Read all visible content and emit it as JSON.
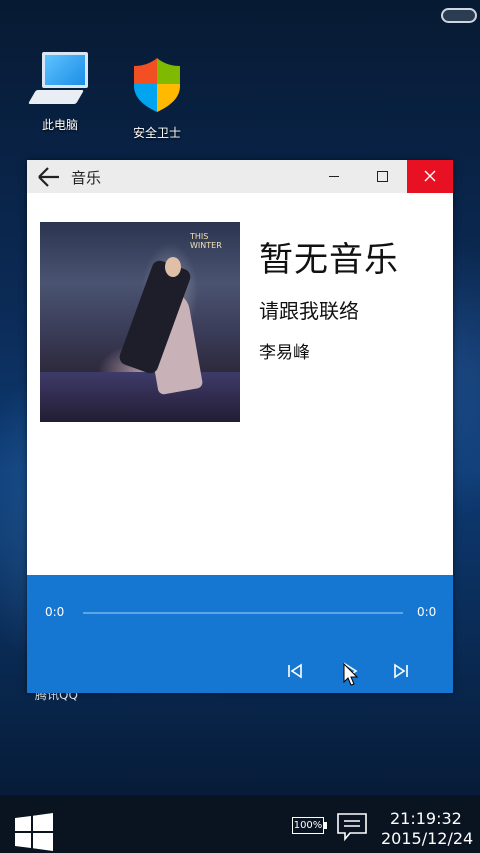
{
  "desktop": {
    "icons": [
      {
        "label": "此电脑",
        "icon": "computer-icon"
      },
      {
        "label": "安全卫士",
        "icon": "shield-icon"
      }
    ],
    "partial_label": "腾讯QQ"
  },
  "window": {
    "title": "音乐",
    "controls": [
      "minimize",
      "maximize",
      "close"
    ],
    "close_color": "#e81123"
  },
  "song": {
    "title": "暂无音乐",
    "subtitle": "请跟我联络",
    "artist": "李易峰"
  },
  "player": {
    "current_time": "0:0",
    "total_time": "0:0",
    "progress": 0,
    "accent_color": "#1677d2"
  },
  "taskbar": {
    "battery": "100%",
    "time": "21:19:32",
    "date": "2015/12/24"
  }
}
